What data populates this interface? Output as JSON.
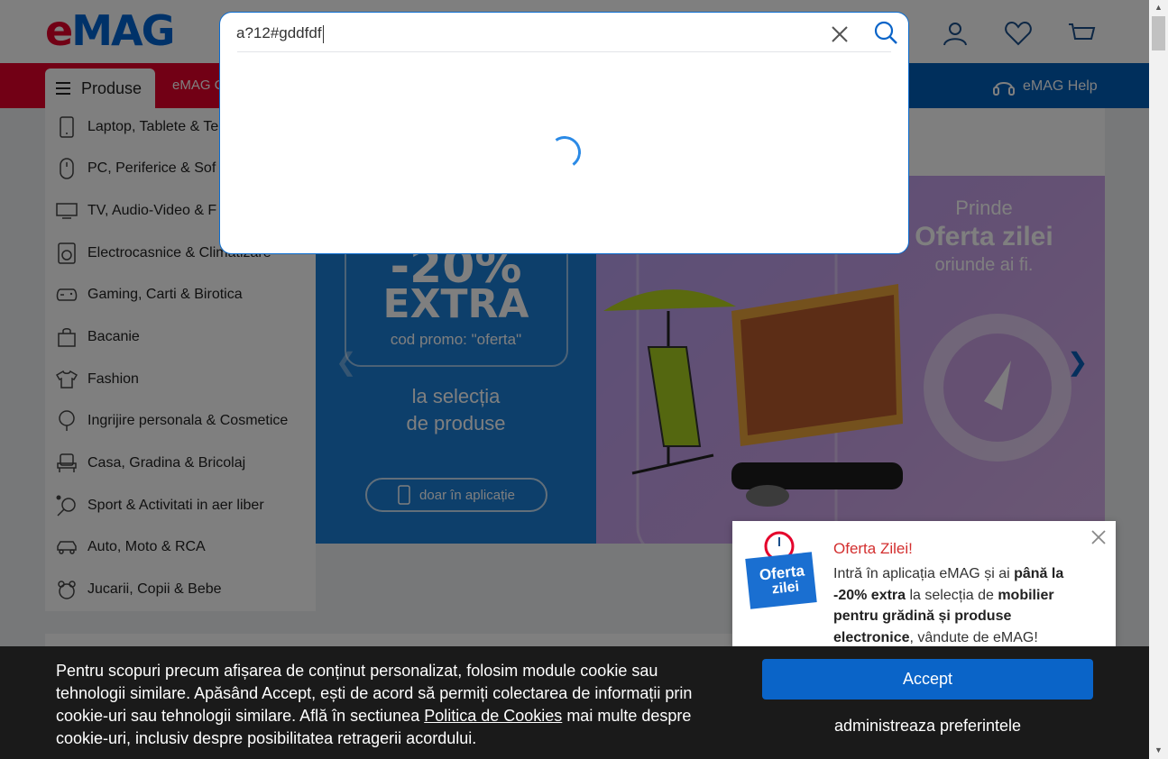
{
  "header": {
    "logo_e": "e",
    "logo_rest": "MAG",
    "icons": [
      "account-icon",
      "favorites-icon",
      "cart-icon"
    ]
  },
  "nav": {
    "produse_label": "Produse",
    "emag_tab_label": "eMAG C",
    "help_label": "eMAG Help"
  },
  "sidebar": {
    "items": [
      {
        "label": "Laptop, Tablete & Te",
        "icon": "phone-icon"
      },
      {
        "label": "PC, Periferice & Sof",
        "icon": "mouse-icon"
      },
      {
        "label": "TV, Audio-Video & F",
        "icon": "tv-icon"
      },
      {
        "label": "Electrocasnice & Climatizare",
        "icon": "washer-icon"
      },
      {
        "label": "Gaming, Carti & Birotica",
        "icon": "gamepad-icon"
      },
      {
        "label": "Bacanie",
        "icon": "bag-icon"
      },
      {
        "label": "Fashion",
        "icon": "shirt-icon"
      },
      {
        "label": "Ingrijire personala & Cosmetice",
        "icon": "care-icon"
      },
      {
        "label": "Casa, Gradina & Bricolaj",
        "icon": "chair-icon"
      },
      {
        "label": "Sport & Activitati in aer liber",
        "icon": "racket-icon"
      },
      {
        "label": "Auto, Moto & RCA",
        "icon": "car-icon"
      },
      {
        "label": "Jucarii, Copii & Bebe",
        "icon": "toy-icon"
      }
    ]
  },
  "search": {
    "value": "a?12#gddfdf",
    "clear_icon": "close-icon",
    "search_icon": "search-icon",
    "loading": true
  },
  "banner": {
    "promo_big": "-20%",
    "promo_extra": "EXTRA",
    "promo_code": "cod promo: \"oferta\"",
    "promo_selection_1": "la selecția",
    "promo_selection_2": "de produse",
    "app_pill_label": "doar în aplicație",
    "prinde": "Prinde",
    "oferta_title": "Oferta zilei",
    "oriunde": "oriunde ai fi."
  },
  "popup": {
    "title": "Oferta Zilei!",
    "body_part1": "Intră în aplicația eMAG și ai ",
    "body_bold1": "până la -20% extra",
    "body_part2": " la selecția de ",
    "body_bold2": "mobilier pentru grădină și produse electronice",
    "body_part3": ", vândute de eMAG!",
    "badge_line1": "Oferta",
    "badge_line2": "zilei"
  },
  "cookie": {
    "text_before_link": "Pentru scopuri precum afișarea de conținut personalizat, folosim module cookie sau tehnologii similare. Apăsând Accept, ești de acord să permiți colectarea de informații prin cookie-uri sau tehnologii similare. Află în sectiunea ",
    "link_text": "Politica de Cookies",
    "text_after_link": " mai multe despre cookie-uri, inclusiv despre posibilitatea retragerii acordului.",
    "accept_label": "Accept",
    "prefs_label": "administreaza preferintele"
  },
  "colors": {
    "brand_red": "#e4002b",
    "brand_blue": "#005eb8",
    "accept_blue": "#0a64c8",
    "popup_title_red": "#d32f2f"
  }
}
